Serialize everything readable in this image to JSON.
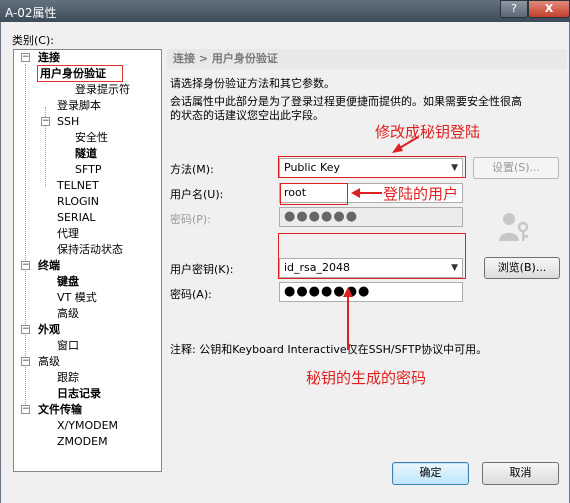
{
  "window": {
    "title": "A-02属性",
    "help_label": "?",
    "close_label": "X"
  },
  "category_label": "类别(C):",
  "tree": {
    "connection": "连接",
    "user_auth": "用户身份验证",
    "login_prompt": "登录提示符",
    "login_script": "登录脚本",
    "ssh": "SSH",
    "security": "安全性",
    "tunnel": "隧道",
    "sftp": "SFTP",
    "telnet": "TELNET",
    "rlogin": "RLOGIN",
    "serial": "SERIAL",
    "proxy": "代理",
    "keepalive": "保持活动状态",
    "terminal": "终端",
    "keyboard": "键盘",
    "vt_mode": "VT 模式",
    "terminal_advanced": "高级",
    "appearance": "外观",
    "window": "窗口",
    "advanced": "高级",
    "trace": "跟踪",
    "logging": "日志记录",
    "file_transfer": "文件传输",
    "xymodem": "X/YMODEM",
    "zmodem": "ZMODEM"
  },
  "panel": {
    "breadcrumb": "连接 > 用户身份验证",
    "intro_line1": "请选择身份验证方法和其它参数。",
    "intro_line2": "会话属性中此部分是为了登录过程更便捷而提供的。如果需要安全性很高",
    "intro_line3": "的状态的话建议您空出此字段。",
    "method_label": "方法(M):",
    "method_value": "Public Key",
    "settings_button": "设置(S)...",
    "username_label": "用户名(U):",
    "username_value": "root",
    "password_label_disabled": "密码(P):",
    "password_value_disabled": "●●●●●●",
    "user_key_label": "用户密钥(K):",
    "user_key_value": "id_rsa_2048",
    "browse_button": "浏览(B)...",
    "passphrase_label": "密码(A):",
    "passphrase_value": "●●●●●●●",
    "note": "注释: 公钥和Keyboard Interactive仅在SSH/SFTP协议中可用。"
  },
  "annotations": {
    "change_to_key": "修改成秘钥登陆",
    "login_user": "登陆的用户",
    "key_password": "秘钥的生成的密码"
  },
  "footer": {
    "ok_button": "确定",
    "cancel_button": "取消"
  },
  "colors": {
    "annotation_red": "#e02020",
    "title_bar": "#4b5866"
  }
}
